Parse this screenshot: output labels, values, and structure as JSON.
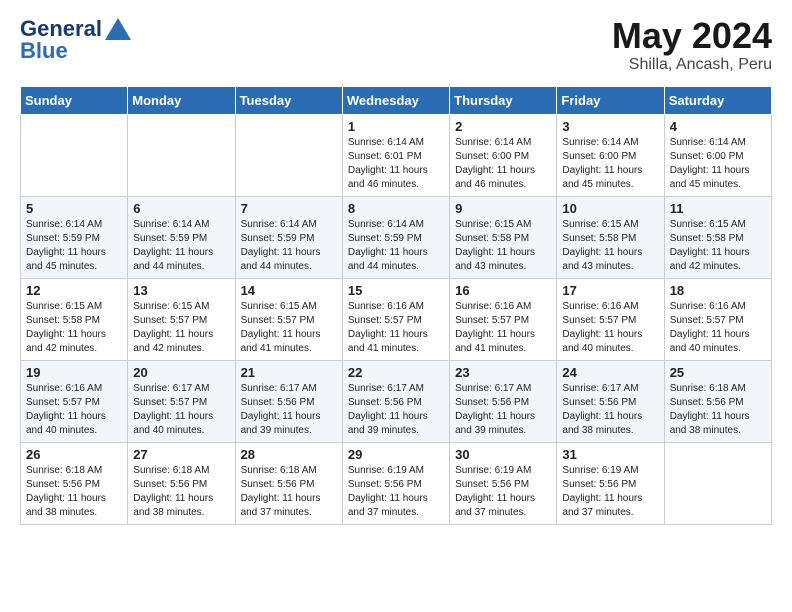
{
  "header": {
    "logo_line1": "General",
    "logo_line2": "Blue",
    "month": "May 2024",
    "location": "Shilla, Ancash, Peru"
  },
  "weekdays": [
    "Sunday",
    "Monday",
    "Tuesday",
    "Wednesday",
    "Thursday",
    "Friday",
    "Saturday"
  ],
  "weeks": [
    [
      {
        "day": "",
        "info": ""
      },
      {
        "day": "",
        "info": ""
      },
      {
        "day": "",
        "info": ""
      },
      {
        "day": "1",
        "info": "Sunrise: 6:14 AM\nSunset: 6:01 PM\nDaylight: 11 hours\nand 46 minutes."
      },
      {
        "day": "2",
        "info": "Sunrise: 6:14 AM\nSunset: 6:00 PM\nDaylight: 11 hours\nand 46 minutes."
      },
      {
        "day": "3",
        "info": "Sunrise: 6:14 AM\nSunset: 6:00 PM\nDaylight: 11 hours\nand 45 minutes."
      },
      {
        "day": "4",
        "info": "Sunrise: 6:14 AM\nSunset: 6:00 PM\nDaylight: 11 hours\nand 45 minutes."
      }
    ],
    [
      {
        "day": "5",
        "info": "Sunrise: 6:14 AM\nSunset: 5:59 PM\nDaylight: 11 hours\nand 45 minutes."
      },
      {
        "day": "6",
        "info": "Sunrise: 6:14 AM\nSunset: 5:59 PM\nDaylight: 11 hours\nand 44 minutes."
      },
      {
        "day": "7",
        "info": "Sunrise: 6:14 AM\nSunset: 5:59 PM\nDaylight: 11 hours\nand 44 minutes."
      },
      {
        "day": "8",
        "info": "Sunrise: 6:14 AM\nSunset: 5:59 PM\nDaylight: 11 hours\nand 44 minutes."
      },
      {
        "day": "9",
        "info": "Sunrise: 6:15 AM\nSunset: 5:58 PM\nDaylight: 11 hours\nand 43 minutes."
      },
      {
        "day": "10",
        "info": "Sunrise: 6:15 AM\nSunset: 5:58 PM\nDaylight: 11 hours\nand 43 minutes."
      },
      {
        "day": "11",
        "info": "Sunrise: 6:15 AM\nSunset: 5:58 PM\nDaylight: 11 hours\nand 42 minutes."
      }
    ],
    [
      {
        "day": "12",
        "info": "Sunrise: 6:15 AM\nSunset: 5:58 PM\nDaylight: 11 hours\nand 42 minutes."
      },
      {
        "day": "13",
        "info": "Sunrise: 6:15 AM\nSunset: 5:57 PM\nDaylight: 11 hours\nand 42 minutes."
      },
      {
        "day": "14",
        "info": "Sunrise: 6:15 AM\nSunset: 5:57 PM\nDaylight: 11 hours\nand 41 minutes."
      },
      {
        "day": "15",
        "info": "Sunrise: 6:16 AM\nSunset: 5:57 PM\nDaylight: 11 hours\nand 41 minutes."
      },
      {
        "day": "16",
        "info": "Sunrise: 6:16 AM\nSunset: 5:57 PM\nDaylight: 11 hours\nand 41 minutes."
      },
      {
        "day": "17",
        "info": "Sunrise: 6:16 AM\nSunset: 5:57 PM\nDaylight: 11 hours\nand 40 minutes."
      },
      {
        "day": "18",
        "info": "Sunrise: 6:16 AM\nSunset: 5:57 PM\nDaylight: 11 hours\nand 40 minutes."
      }
    ],
    [
      {
        "day": "19",
        "info": "Sunrise: 6:16 AM\nSunset: 5:57 PM\nDaylight: 11 hours\nand 40 minutes."
      },
      {
        "day": "20",
        "info": "Sunrise: 6:17 AM\nSunset: 5:57 PM\nDaylight: 11 hours\nand 40 minutes."
      },
      {
        "day": "21",
        "info": "Sunrise: 6:17 AM\nSunset: 5:56 PM\nDaylight: 11 hours\nand 39 minutes."
      },
      {
        "day": "22",
        "info": "Sunrise: 6:17 AM\nSunset: 5:56 PM\nDaylight: 11 hours\nand 39 minutes."
      },
      {
        "day": "23",
        "info": "Sunrise: 6:17 AM\nSunset: 5:56 PM\nDaylight: 11 hours\nand 39 minutes."
      },
      {
        "day": "24",
        "info": "Sunrise: 6:17 AM\nSunset: 5:56 PM\nDaylight: 11 hours\nand 38 minutes."
      },
      {
        "day": "25",
        "info": "Sunrise: 6:18 AM\nSunset: 5:56 PM\nDaylight: 11 hours\nand 38 minutes."
      }
    ],
    [
      {
        "day": "26",
        "info": "Sunrise: 6:18 AM\nSunset: 5:56 PM\nDaylight: 11 hours\nand 38 minutes."
      },
      {
        "day": "27",
        "info": "Sunrise: 6:18 AM\nSunset: 5:56 PM\nDaylight: 11 hours\nand 38 minutes."
      },
      {
        "day": "28",
        "info": "Sunrise: 6:18 AM\nSunset: 5:56 PM\nDaylight: 11 hours\nand 37 minutes."
      },
      {
        "day": "29",
        "info": "Sunrise: 6:19 AM\nSunset: 5:56 PM\nDaylight: 11 hours\nand 37 minutes."
      },
      {
        "day": "30",
        "info": "Sunrise: 6:19 AM\nSunset: 5:56 PM\nDaylight: 11 hours\nand 37 minutes."
      },
      {
        "day": "31",
        "info": "Sunrise: 6:19 AM\nSunset: 5:56 PM\nDaylight: 11 hours\nand 37 minutes."
      },
      {
        "day": "",
        "info": ""
      }
    ]
  ]
}
